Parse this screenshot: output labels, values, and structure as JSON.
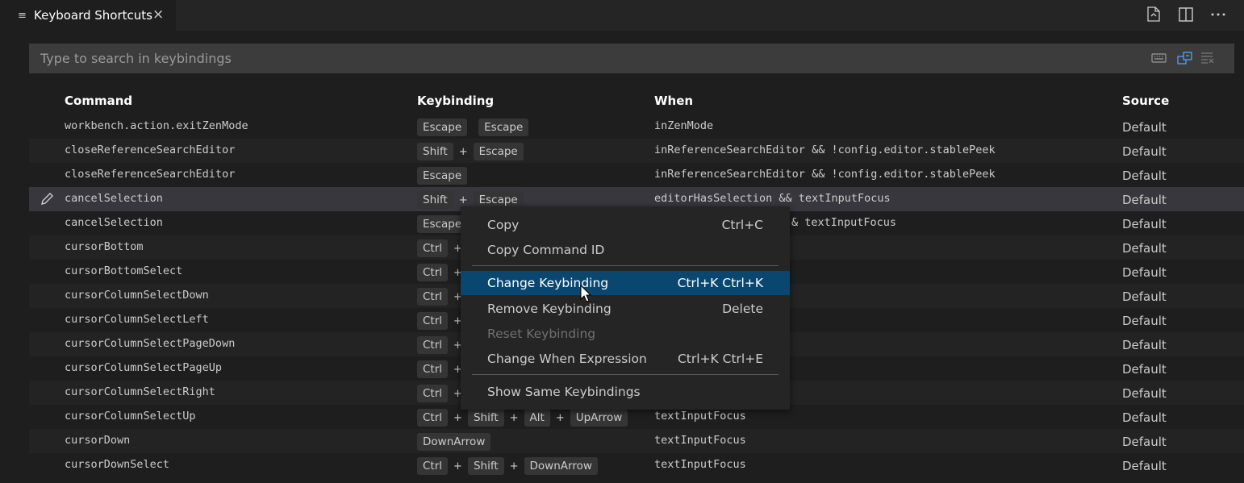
{
  "tab": {
    "title": "Keyboard Shortcuts",
    "close": "×",
    "icon": "≡"
  },
  "editor_actions": [
    "open-keybindings-json-icon",
    "split-editor-icon",
    "more-actions-icon"
  ],
  "search": {
    "placeholder": "Type to search in keybindings",
    "icons": [
      "record-keys-icon",
      "sort-by-precedence-icon",
      "clear-search-icon"
    ]
  },
  "table": {
    "headers": {
      "command": "Command",
      "keybinding": "Keybinding",
      "when": "When",
      "source": "Source"
    },
    "rows": [
      {
        "command": "workbench.action.exitZenMode",
        "keys": [
          "Escape",
          " ",
          "Escape"
        ],
        "when": "inZenMode",
        "source": "Default"
      },
      {
        "command": "closeReferenceSearchEditor",
        "keys": [
          "Shift",
          "+",
          "Escape"
        ],
        "when": "inReferenceSearchEditor && !config.editor.stablePeek",
        "source": "Default"
      },
      {
        "command": "closeReferenceSearchEditor",
        "keys": [
          "Escape"
        ],
        "when": "inReferenceSearchEditor && !config.editor.stablePeek",
        "source": "Default"
      },
      {
        "command": "cancelSelection",
        "keys": [
          "Shift",
          "+",
          "Escape"
        ],
        "when": "editorHasSelection && textInputFocus",
        "source": "Default"
      },
      {
        "command": "cancelSelection",
        "keys": [
          "Escape"
        ],
        "when": "& textInputFocus",
        "source": "Default"
      },
      {
        "command": "cursorBottom",
        "keys": [
          "Ctrl",
          "+"
        ],
        "when": "",
        "source": "Default"
      },
      {
        "command": "cursorBottomSelect",
        "keys": [
          "Ctrl",
          "+"
        ],
        "when": "",
        "source": "Default"
      },
      {
        "command": "cursorColumnSelectDown",
        "keys": [
          "Ctrl",
          "+"
        ],
        "when": "",
        "source": "Default"
      },
      {
        "command": "cursorColumnSelectLeft",
        "keys": [
          "Ctrl",
          "+"
        ],
        "when": "",
        "source": "Default"
      },
      {
        "command": "cursorColumnSelectPageDown",
        "keys": [
          "Ctrl",
          "+"
        ],
        "when": "",
        "source": "Default"
      },
      {
        "command": "cursorColumnSelectPageUp",
        "keys": [
          "Ctrl",
          "+"
        ],
        "when": "",
        "source": "Default"
      },
      {
        "command": "cursorColumnSelectRight",
        "keys": [
          "Ctrl",
          "+"
        ],
        "when": "",
        "source": "Default"
      },
      {
        "command": "cursorColumnSelectUp",
        "keys": [
          "Ctrl",
          "+",
          "Shift",
          "+",
          "Alt",
          "+",
          "UpArrow"
        ],
        "when": "textInputFocus",
        "source": "Default"
      },
      {
        "command": "cursorDown",
        "keys": [
          "DownArrow"
        ],
        "when": "textInputFocus",
        "source": "Default"
      },
      {
        "command": "cursorDownSelect",
        "keys": [
          "Ctrl",
          "+",
          "Shift",
          "+",
          "DownArrow"
        ],
        "when": "textInputFocus",
        "source": "Default"
      }
    ]
  },
  "context_menu": {
    "items": [
      {
        "label": "Copy",
        "shortcut": "Ctrl+C"
      },
      {
        "label": "Copy Command ID",
        "shortcut": ""
      },
      {
        "label": "Change Keybinding",
        "shortcut": "Ctrl+K Ctrl+K"
      },
      {
        "label": "Remove Keybinding",
        "shortcut": "Delete"
      },
      {
        "label": "Reset Keybinding",
        "shortcut": ""
      },
      {
        "label": "Change When Expression",
        "shortcut": "Ctrl+K Ctrl+E"
      },
      {
        "label": "Show Same Keybindings",
        "shortcut": ""
      }
    ]
  },
  "colors": {
    "background": "#1e1e1e",
    "menu_highlight": "#094771",
    "search_bg": "#3c3c3c",
    "focused_row": "#37373d"
  }
}
